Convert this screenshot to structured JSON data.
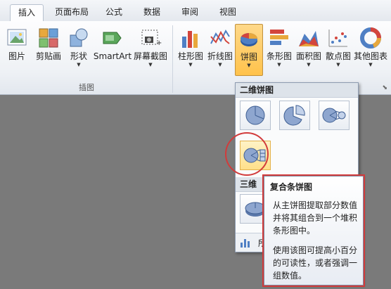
{
  "tabs": [
    {
      "label": "插入",
      "active": true
    },
    {
      "label": "页面布局"
    },
    {
      "label": "公式"
    },
    {
      "label": "数据"
    },
    {
      "label": "审阅"
    },
    {
      "label": "视图"
    }
  ],
  "ribbon": {
    "illustrations_group": {
      "label": "插图",
      "buttons": [
        {
          "label": "图片",
          "icon": "picture-icon"
        },
        {
          "label": "剪贴画",
          "icon": "clipart-icon"
        },
        {
          "label": "形状",
          "icon": "shapes-icon",
          "has_dropdown": true
        },
        {
          "label": "SmartArt",
          "icon": "smartart-icon"
        },
        {
          "label": "屏幕截图",
          "icon": "screenshot-icon",
          "has_dropdown": true
        }
      ]
    },
    "charts_group": {
      "buttons": [
        {
          "label": "柱形图",
          "icon": "column-chart-icon"
        },
        {
          "label": "折线图",
          "icon": "line-chart-icon"
        },
        {
          "label": "饼图",
          "icon": "pie-chart-icon",
          "pressed": true
        },
        {
          "label": "条形图",
          "icon": "bar-chart-icon"
        },
        {
          "label": "面积图",
          "icon": "area-chart-icon"
        },
        {
          "label": "散点图",
          "icon": "scatter-chart-icon"
        },
        {
          "label": "其他图表",
          "icon": "other-charts-icon"
        }
      ]
    }
  },
  "dropdown": {
    "section_2d": "二维饼图",
    "section_3d_partial": "三维",
    "footer_partial": "所"
  },
  "tooltip": {
    "title": "复合条饼图",
    "para1": "从主饼图提取部分数值并将其组合到一个堆积条形图中。",
    "para2": "使用该图可提高小百分的可读性，或者强调一组数值。"
  },
  "colors": {
    "highlight": "#d23b3b",
    "pressed": "#ffc24b",
    "pie_blue": "#8ea6cf"
  }
}
